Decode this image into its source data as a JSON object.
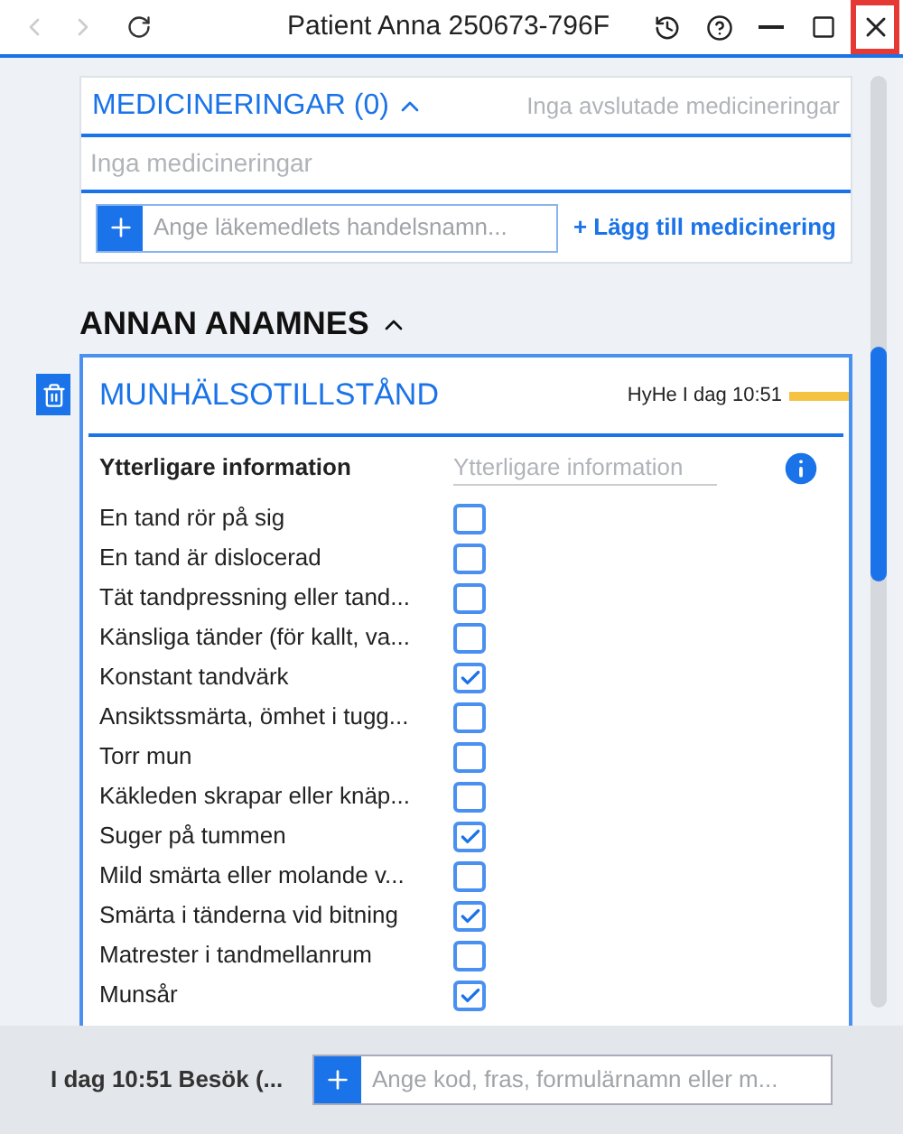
{
  "window": {
    "title": "Patient Anna 250673-796F",
    "close_highlighted": true
  },
  "medications": {
    "title": "MEDICINERINGAR (0)",
    "expanded": true,
    "ended_note": "Inga avslutade medicineringar",
    "empty_text": "Inga medicineringar",
    "search_placeholder": "Ange läkemedlets handelsnamn...",
    "add_link": "+ Lägg till medicinering"
  },
  "section": {
    "title": "ANNAN ANAMNES",
    "expanded": true
  },
  "form": {
    "title": "MUNHÄLSOTILLSTÅND",
    "signature": "HyHe I dag 10:51",
    "info_label": "Ytterligare information",
    "info_placeholder": "Ytterligare information",
    "items": [
      {
        "label": "En tand rör på sig",
        "checked": false
      },
      {
        "label": "En tand är dislocerad",
        "checked": false
      },
      {
        "label": "Tät tandpressning eller tand...",
        "checked": false
      },
      {
        "label": "Känsliga tänder (för kallt, va...",
        "checked": false
      },
      {
        "label": "Konstant tandvärk",
        "checked": true
      },
      {
        "label": "Ansiktssmärta, ömhet i tugg...",
        "checked": false
      },
      {
        "label": "Torr mun",
        "checked": false
      },
      {
        "label": "Käkleden skrapar eller knäp...",
        "checked": false
      },
      {
        "label": "Suger på tummen",
        "checked": true
      },
      {
        "label": "Mild smärta eller molande v...",
        "checked": false
      },
      {
        "label": "Smärta i tänderna vid bitning",
        "checked": true
      },
      {
        "label": "Matrester i tandmellanrum",
        "checked": false
      },
      {
        "label": "Munsår",
        "checked": true
      }
    ]
  },
  "footer": {
    "visit": "I dag 10:51 Besök (...",
    "input_placeholder": "Ange kod, fras, formulärnamn eller m..."
  }
}
